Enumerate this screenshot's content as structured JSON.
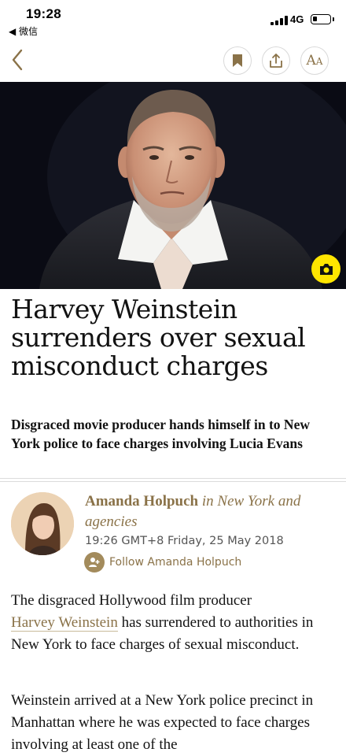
{
  "status_bar": {
    "time": "19:28",
    "back_app": "◀ 微信",
    "network": "4G"
  },
  "toolbar": {
    "icons": [
      "back-chevron-icon",
      "bookmark-icon",
      "share-icon",
      "font-size-icon"
    ],
    "font_button_big": "A",
    "font_button_small": "A"
  },
  "accent_color": "#8a7248",
  "article": {
    "headline": "Harvey Weinstein surrenders over sexual misconduct charges",
    "standfirst": "Disgraced movie producer hands himself in to New York police to face charges involving Lucia Evans",
    "byline": {
      "author": "Amanda Holpuch",
      "location": "in New York and agencies",
      "dateline": "19:26 GMT+8 Friday, 25 May 2018",
      "follow_label": "Follow Amanda Holpuch"
    },
    "p1": {
      "before_link": "The disgraced Hollywood film producer",
      "link": "Harvey Weinstein",
      "after_link": "has surrendered to authorities in New York to face charges of sexual misconduct."
    },
    "p2": "Weinstein arrived at a New York police precinct in Manhattan where he was expected to face charges involving at least one of the"
  }
}
